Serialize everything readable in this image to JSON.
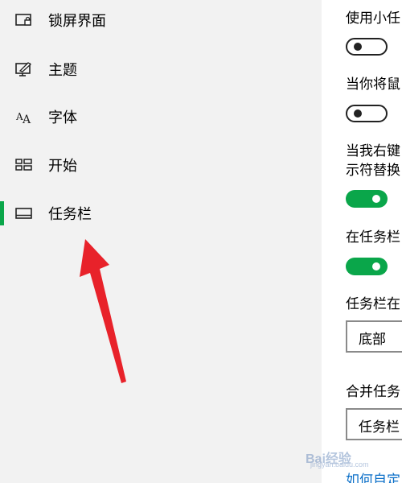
{
  "sidebar": {
    "items": [
      {
        "label": "锁屏界面",
        "icon": "lock-screen-icon",
        "selected": false
      },
      {
        "label": "主题",
        "icon": "theme-icon",
        "selected": false
      },
      {
        "label": "字体",
        "icon": "font-icon",
        "selected": false
      },
      {
        "label": "开始",
        "icon": "start-icon",
        "selected": false
      },
      {
        "label": "任务栏",
        "icon": "taskbar-icon",
        "selected": true
      }
    ]
  },
  "content": {
    "settings": [
      {
        "label": "使用小任",
        "toggle": "off"
      },
      {
        "label": "当你将鼠",
        "toggle": "off"
      },
      {
        "label_lines": [
          "当我右键",
          "示符替换"
        ],
        "toggle": "on"
      },
      {
        "label": "在任务栏",
        "toggle": "on"
      }
    ],
    "position_setting": {
      "label": "任务栏在",
      "value": "底部"
    },
    "combine_setting": {
      "label": "合并任务",
      "value": "任务栏"
    },
    "link": "如何自定"
  },
  "annotation": {
    "arrow_color": "#e8222a"
  },
  "colors": {
    "accent": "#0aa64a",
    "sidebar_bg": "#f2f2f2"
  },
  "watermark": {
    "text": "Bai经验",
    "subtext": "jingyan.baidu.com"
  }
}
